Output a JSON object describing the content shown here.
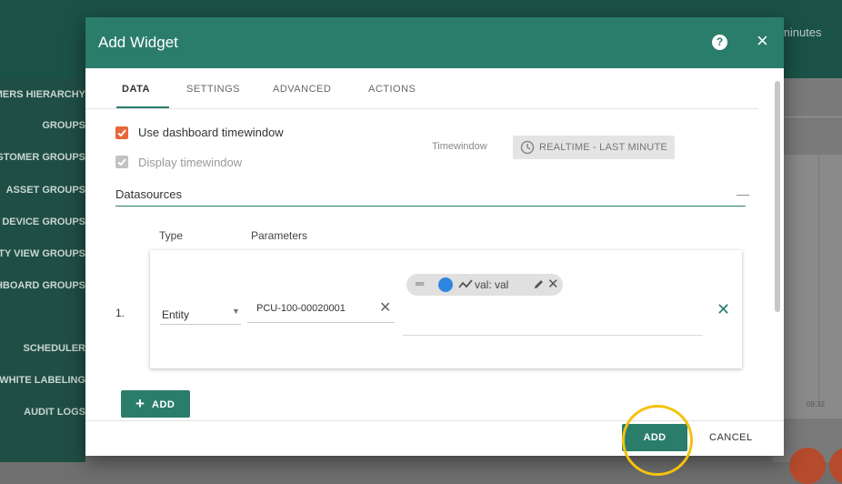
{
  "background": {
    "topbar_right_text": "minutes",
    "sidebar_items": [
      "CUSTOMERS HIERARCHY",
      "GROUPS",
      "CUSTOMER GROUPS",
      "ASSET GROUPS",
      "DEVICE GROUPS",
      "ENTITY VIEW GROUPS",
      "DASHBOARD GROUPS",
      "SCHEDULER",
      "WHITE LABELING",
      "AUDIT LOGS"
    ],
    "axis_tick": "09:32"
  },
  "dialog": {
    "title": "Add Widget",
    "help_icon": "help-circle-icon",
    "close_icon": "close-icon",
    "tabs": [
      {
        "label": "DATA",
        "active": true
      },
      {
        "label": "SETTINGS",
        "active": false
      },
      {
        "label": "ADVANCED",
        "active": false
      },
      {
        "label": "ACTIONS",
        "active": false
      }
    ],
    "use_dashboard_timewindow": {
      "label": "Use dashboard timewindow",
      "checked": true
    },
    "display_timewindow": {
      "label": "Display timewindow",
      "checked": true,
      "disabled": true
    },
    "timewindow": {
      "label": "Timewindow",
      "value": "REALTIME - LAST MINUTE"
    },
    "datasources": {
      "title": "Datasources",
      "col_type": "Type",
      "col_params": "Parameters",
      "rows": [
        {
          "index": "1.",
          "type": "Entity",
          "entity": "PCU-100-00020001",
          "data_key": {
            "label": "val: val",
            "color": "#2e86de"
          }
        }
      ],
      "add_label": "ADD"
    },
    "footer": {
      "add_label": "ADD",
      "cancel_label": "CANCEL"
    }
  },
  "colors": {
    "primary": "#2a7d6b",
    "checkbox_checked": "#e6673b",
    "highlight_ring": "#f4c20d"
  }
}
